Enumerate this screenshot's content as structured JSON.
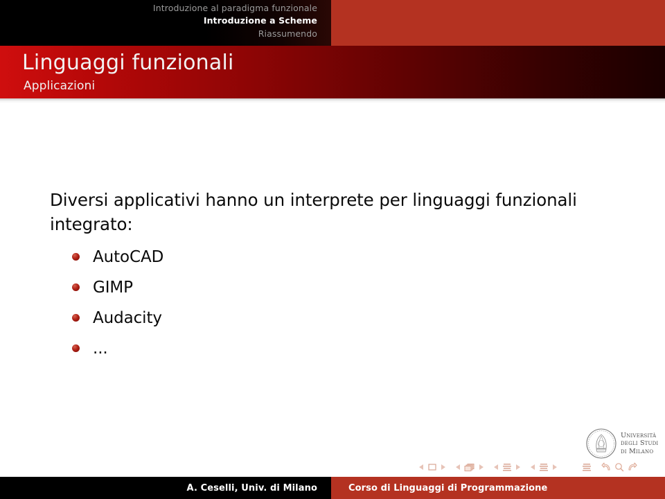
{
  "header": {
    "nav_items": [
      {
        "label": "Introduzione al paradigma funzionale",
        "active": false
      },
      {
        "label": "Introduzione a Scheme",
        "active": true
      },
      {
        "label": "Riassumendo",
        "active": false
      }
    ],
    "accent_color": "#b43221",
    "inactive_color": "#9b9b9b",
    "active_color": "#ffffff"
  },
  "title_bar": {
    "title": "Linguaggi funzionali",
    "subtitle": "Applicazioni",
    "gradient_from": "#cf0e0e",
    "gradient_to": "#1a0000"
  },
  "content": {
    "intro_text": "Diversi applicativi hanno un interprete per linguaggi funzionali integrato:",
    "bullets": [
      {
        "label": "AutoCAD"
      },
      {
        "label": "GIMP"
      },
      {
        "label": "Audacity"
      },
      {
        "label": "..."
      }
    ],
    "bullet_color": "#b4241a"
  },
  "logo": {
    "crest_icon": "university-crest-icon",
    "line1": "Università",
    "line2": "degli Studi",
    "line3": "di Milano"
  },
  "nav_symbols": {
    "color": "#e2b5a6",
    "groups": [
      {
        "icon": "slide-icon",
        "prev": "prev-slide-arrow",
        "next": "next-slide-arrow"
      },
      {
        "icon": "frame-stack-icon",
        "prev": "prev-frame-arrow",
        "next": "next-frame-arrow"
      },
      {
        "icon": "subsection-icon",
        "prev": "prev-subsection-arrow",
        "next": "next-subsection-arrow"
      },
      {
        "icon": "section-icon",
        "prev": "prev-section-arrow",
        "next": "next-section-arrow"
      }
    ],
    "standalone_icon": "document-icon",
    "back_icon": "go-back-icon",
    "search_icon": "search-icon",
    "forward_icon": "go-forward-icon"
  },
  "footer": {
    "author": "A. Ceselli, Univ. di Milano",
    "course": "Corso di Linguaggi di Programmazione",
    "left_bg": "#000000",
    "right_bg": "#b43221"
  }
}
